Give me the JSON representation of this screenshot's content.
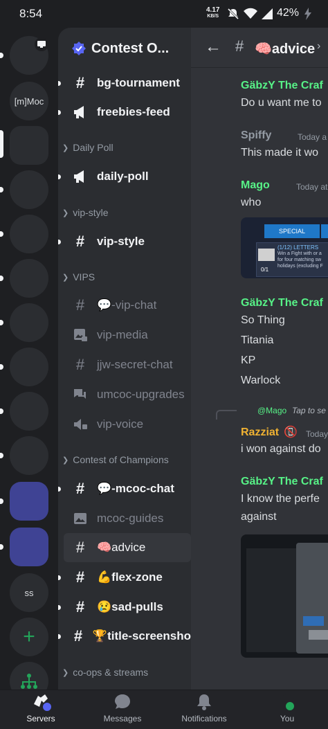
{
  "status_bar": {
    "time": "8:54",
    "net_speed": "4.17",
    "net_unit": "KB/S",
    "battery": "42%"
  },
  "server_rail": {
    "items": [
      {
        "label": ""
      },
      {
        "label": "[m]Moc"
      },
      {
        "label": ""
      },
      {
        "label": ""
      },
      {
        "label": ""
      },
      {
        "label": ""
      },
      {
        "label": ""
      },
      {
        "label": ""
      },
      {
        "label": ""
      },
      {
        "label": ""
      },
      {
        "label": ""
      },
      {
        "label": ""
      },
      {
        "label": "ss"
      }
    ]
  },
  "guild": {
    "name": "Contest O..."
  },
  "channels": {
    "bg_tournament": "bg-tournament",
    "freebies_feed": "freebies-feed",
    "cat_daily_poll": "Daily Poll",
    "daily_poll": "daily-poll",
    "cat_vip_style": "vip-style",
    "vip_style": "vip-style",
    "cat_vips": "VIPS",
    "vip_chat": "💬-vip-chat",
    "vip_media": "vip-media",
    "jjw_secret_chat": "jjw-secret-chat",
    "umcoc_upgrades": "umcoc-upgrades",
    "vip_voice": "vip-voice",
    "cat_contest": "Contest of Champions",
    "mcoc_chat": "💬-mcoc-chat",
    "mcoc_guides": "mcoc-guides",
    "advice": "🧠advice",
    "flex_zone": "💪flex-zone",
    "sad_pulls": "😢sad-pulls",
    "title_screenshots": "🏆title-screensho",
    "cat_coops": "co-ops & streams"
  },
  "chat": {
    "title": "🧠advice",
    "messages": [
      {
        "author": "GäbzY The Craf",
        "time": "",
        "text": "Do u want me to"
      },
      {
        "author": "Spiffy",
        "time": "Today a",
        "text": "This made it wo"
      },
      {
        "author": "Mago",
        "time": "Today at",
        "text": "who"
      },
      {
        "author": "GäbzY The Craf",
        "time": "",
        "lines": [
          "So Thing",
          "Titania",
          "KP",
          "Warlock"
        ]
      },
      {
        "reply_to": "@Mago",
        "reply_hint": "Tap to se"
      },
      {
        "author": "Razziat",
        "badge": "📵",
        "time": "Today",
        "text": "i won against do"
      },
      {
        "author": "GäbzY The Craf",
        "time": "",
        "lines": [
          "I know the perfe",
          "against"
        ]
      }
    ],
    "embed1": {
      "tab": "SPECIAL",
      "quest": "(1/12) LETTERS",
      "line1": "Win a Fight with or a",
      "line2": "for four matching sw",
      "line3": "holidays (excluding F",
      "progress": "0/1"
    }
  },
  "bottom_nav": {
    "servers": "Servers",
    "messages": "Messages",
    "notifications": "Notifications",
    "you": "You"
  },
  "colors": {
    "accent_green": "#57f287",
    "brand_blurple": "#5865f2",
    "reply_name": "#f0b232"
  }
}
